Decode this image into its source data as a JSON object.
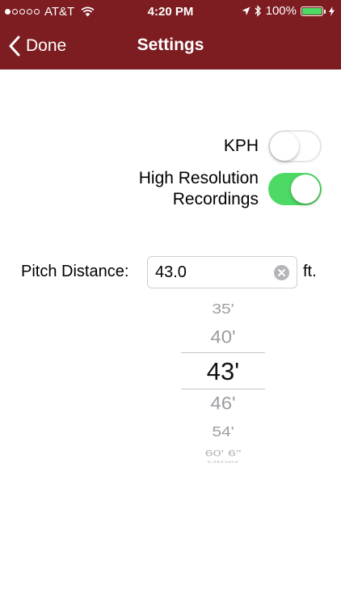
{
  "status_bar": {
    "carrier": "AT&T",
    "time": "4:20 PM",
    "battery": "100%",
    "signal_strength_dots": 1,
    "icons": [
      "wifi-icon",
      "location-arrow-icon",
      "bluetooth-icon",
      "battery-icon",
      "charging-bolt-icon"
    ]
  },
  "nav": {
    "back_label": "Done",
    "title": "Settings",
    "back_icon": "chevron-left-icon"
  },
  "settings": {
    "kph": {
      "label": "KPH",
      "enabled": false
    },
    "high_res": {
      "label_line1": "High Resolution",
      "label_line2": "Recordings",
      "enabled": true
    }
  },
  "pitch": {
    "label": "Pitch Distance:",
    "value": "43.0",
    "unit": "ft.",
    "clear_icon": "clear-circle-icon"
  },
  "picker": {
    "options": [
      "35'",
      "40'",
      "43'",
      "46'",
      "54'",
      "60' 6\"",
      "Other"
    ],
    "selected": "43'"
  },
  "colors": {
    "nav_background": "#7d1c21",
    "toggle_on": "#4cd964",
    "toggle_off_border": "#e5e5ea",
    "picker_text": "#9d9da2"
  }
}
